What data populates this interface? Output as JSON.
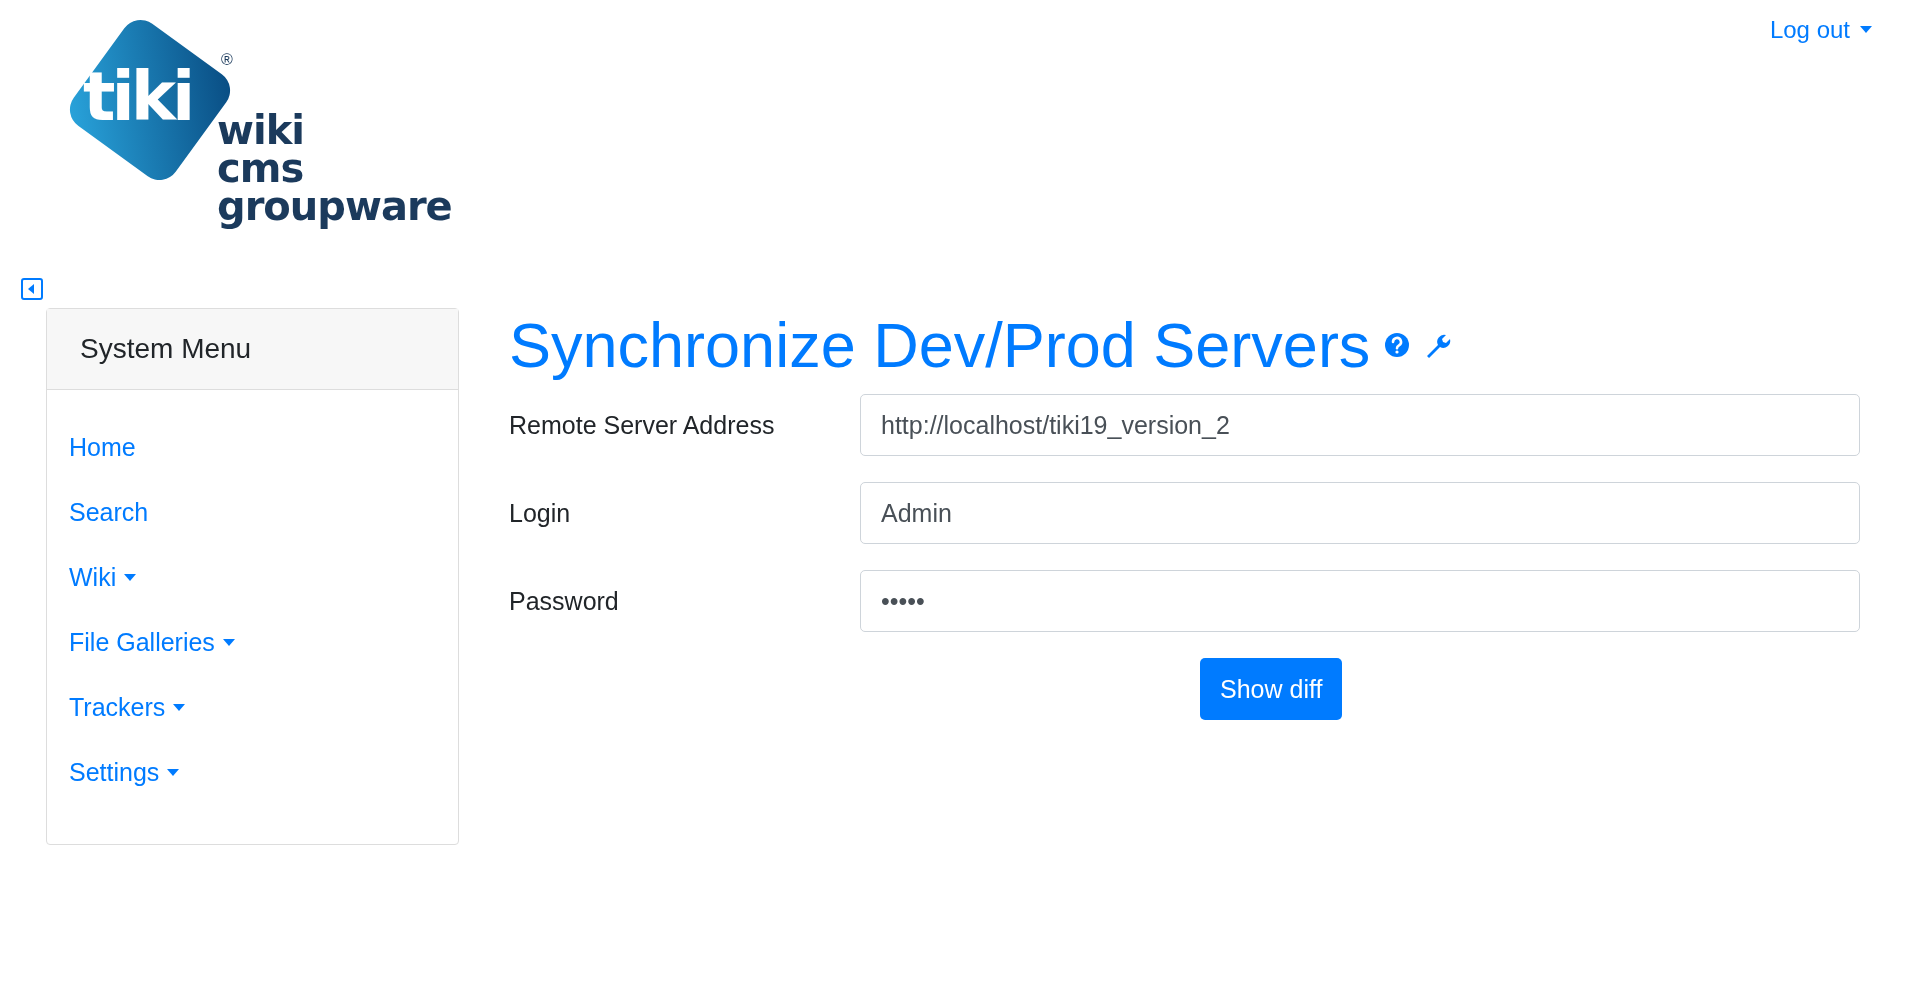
{
  "header": {
    "logo": {
      "mark": "tiki",
      "registered": "®",
      "lines": [
        "wiki",
        "cms",
        "groupware"
      ]
    },
    "user_menu": {
      "label": "Log out"
    }
  },
  "sidebar": {
    "title": "System Menu",
    "items": [
      {
        "label": "Home",
        "has_submenu": false
      },
      {
        "label": "Search",
        "has_submenu": false
      },
      {
        "label": "Wiki",
        "has_submenu": true
      },
      {
        "label": "File Galleries",
        "has_submenu": true
      },
      {
        "label": "Trackers",
        "has_submenu": true
      },
      {
        "label": "Settings",
        "has_submenu": true
      }
    ]
  },
  "page": {
    "title": "Synchronize Dev/Prod Servers",
    "fields": [
      {
        "label": "Remote Server Address",
        "value": "http://localhost/tiki19_version_2"
      },
      {
        "label": "Login",
        "value": "Admin"
      },
      {
        "label": "Password",
        "value": "•••••"
      }
    ],
    "submit": "Show diff"
  }
}
